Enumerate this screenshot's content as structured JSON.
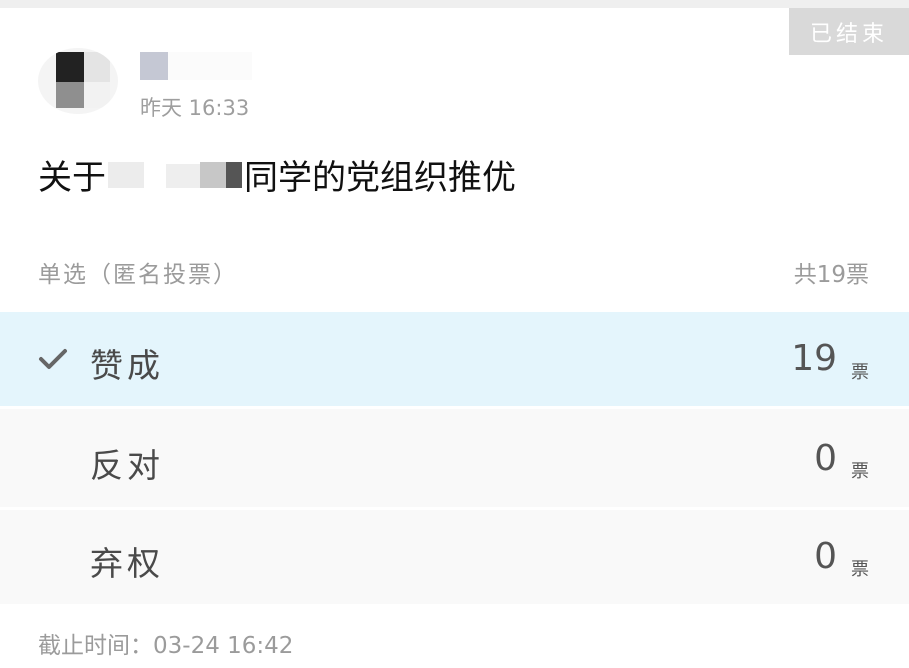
{
  "status_badge": "已结束",
  "post_time": "昨天 16:33",
  "title_prefix": "关于",
  "title_suffix": "同学的党组织推优",
  "vote_type": "单选（匿名投票）",
  "total_votes": "共19票",
  "options": [
    {
      "label": "赞成",
      "count": "19",
      "unit": "票",
      "selected": true
    },
    {
      "label": "反对",
      "count": "0",
      "unit": "票",
      "selected": false
    },
    {
      "label": "弃权",
      "count": "0",
      "unit": "票",
      "selected": false
    }
  ],
  "deadline": "截止时间：03-24 16:42",
  "colors": {
    "selected_background": "#e4f5fc",
    "option_background": "#f9f9f9",
    "badge_background": "#d9d9d9"
  },
  "icons": {
    "selected_marker": "check-icon"
  }
}
